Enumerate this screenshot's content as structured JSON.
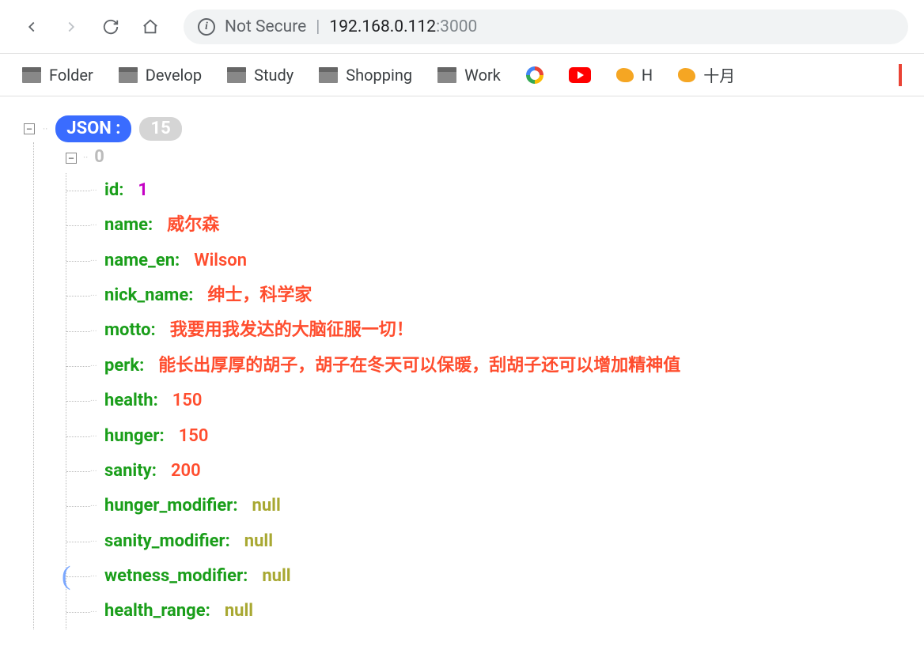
{
  "browser": {
    "security_label": "Not Secure",
    "url_host": "192.168.0.112",
    "url_port": ":3000"
  },
  "bookmarks": {
    "folder": "Folder",
    "develop": "Develop",
    "study": "Study",
    "shopping": "Shopping",
    "work": "Work",
    "h": "H",
    "cn": "十月"
  },
  "viewer": {
    "root_label": "JSON :",
    "count": "15",
    "index": "0"
  },
  "record": {
    "keys": {
      "id": "id",
      "name": "name",
      "name_en": "name_en",
      "nick_name": "nick_name",
      "motto": "motto",
      "perk": "perk",
      "health": "health",
      "hunger": "hunger",
      "sanity": "sanity",
      "hunger_modifier": "hunger_modifier",
      "sanity_modifier": "sanity_modifier",
      "wetness_modifier": "wetness_modifier",
      "health_range": "health_range"
    },
    "values": {
      "id": "1",
      "name": "威尔森",
      "name_en": "Wilson",
      "nick_name": "绅士，科学家",
      "motto": "我要用我发达的大脑征服一切！",
      "perk": "能长出厚厚的胡子，胡子在冬天可以保暖，刮胡子还可以增加精神值",
      "health": "150",
      "hunger": "150",
      "sanity": "200",
      "hunger_modifier": "null",
      "sanity_modifier": "null",
      "wetness_modifier": "null",
      "health_range": "null"
    }
  }
}
